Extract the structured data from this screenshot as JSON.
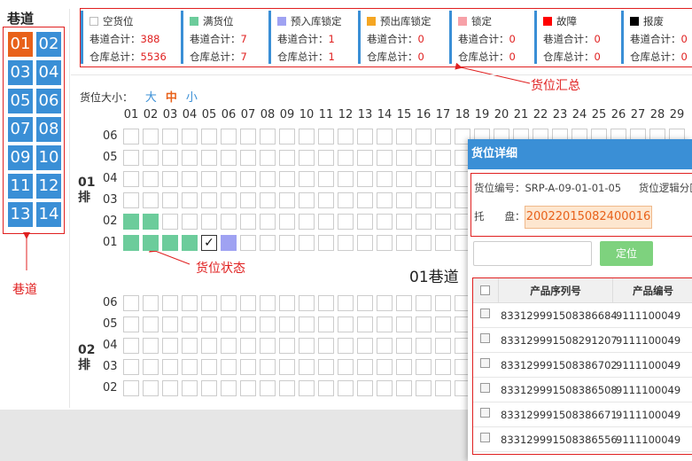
{
  "lanes": {
    "title": "巷道",
    "items": [
      "01",
      "02",
      "03",
      "04",
      "05",
      "06",
      "07",
      "08",
      "09",
      "10",
      "11",
      "12",
      "13",
      "14"
    ],
    "active": "01"
  },
  "legend": {
    "items": [
      {
        "name": "空货位",
        "color": "#ffffff",
        "lane_label": "巷道合计：",
        "lane_total": "388",
        "wh_label": "仓库总计：",
        "wh_total": "5536"
      },
      {
        "name": "满货位",
        "color": "#6ccc9b",
        "lane_label": "巷道合计：",
        "lane_total": "7",
        "wh_label": "仓库总计：",
        "wh_total": "7"
      },
      {
        "name": "预入库锁定",
        "color": "#9fa2f2",
        "lane_label": "巷道合计：",
        "lane_total": "1",
        "wh_label": "仓库总计：",
        "wh_total": "1"
      },
      {
        "name": "预出库锁定",
        "color": "#f5a623",
        "lane_label": "巷道合计：",
        "lane_total": "0",
        "wh_label": "仓库总计：",
        "wh_total": "0"
      },
      {
        "name": "锁定",
        "color": "#f7a1a8",
        "lane_label": "巷道合计：",
        "lane_total": "0",
        "wh_label": "仓库总计：",
        "wh_total": "0"
      },
      {
        "name": "故障",
        "color": "#ff0000",
        "lane_label": "巷道合计：",
        "lane_total": "0",
        "wh_label": "仓库总计：",
        "wh_total": "0"
      },
      {
        "name": "报废",
        "color": "#000000",
        "lane_label": "巷道合计：",
        "lane_total": "0",
        "wh_label": "仓库总计：",
        "wh_total": "0"
      }
    ]
  },
  "annotations": {
    "summary": "货位汇总",
    "status": "货位状态",
    "lane": "巷道"
  },
  "size": {
    "label": "货位大小：",
    "options": [
      "大",
      "中",
      "小"
    ],
    "active": "中"
  },
  "grid": {
    "columns": [
      "01",
      "02",
      "03",
      "04",
      "05",
      "06",
      "07",
      "08",
      "09",
      "10",
      "11",
      "12",
      "13",
      "14",
      "15",
      "16",
      "17",
      "18",
      "19",
      "20",
      "21",
      "22",
      "23",
      "24",
      "25",
      "26",
      "27",
      "28",
      "29"
    ],
    "levels": [
      "06",
      "05",
      "04",
      "03",
      "02",
      "01"
    ],
    "row1": {
      "label": "01排"
    },
    "row2": {
      "label": "02排"
    },
    "row2_levels": [
      "06",
      "05",
      "04",
      "03",
      "02"
    ],
    "caption": "01巷道"
  },
  "detail": {
    "title": "货位详细",
    "loc_label": "货位编号：",
    "loc_value": "SRP-A-09-01-01-05",
    "area_label": "货位逻辑分区：",
    "tray_label": "托　　盘：",
    "tray_value": "20022015082400016",
    "locate_btn": "定位",
    "col_serial": "产品序列号",
    "col_code": "产品编号",
    "rows": [
      {
        "serial": "833129991508386684",
        "code": "9111100049"
      },
      {
        "serial": "833129991508291207",
        "code": "9111100049"
      },
      {
        "serial": "833129991508386702",
        "code": "9111100049"
      },
      {
        "serial": "833129991508386508",
        "code": "9111100049"
      },
      {
        "serial": "833129991508386671",
        "code": "9111100049"
      },
      {
        "serial": "833129991508386556",
        "code": "9111100049"
      }
    ]
  }
}
